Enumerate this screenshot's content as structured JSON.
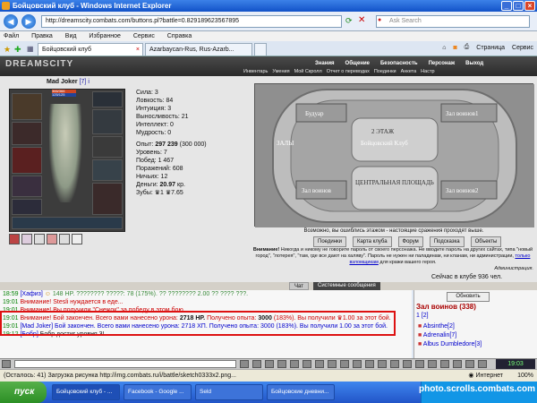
{
  "window": {
    "title": "Бойцовский клуб - Windows Internet Explorer"
  },
  "address": {
    "url": "http://dreamscity.combats.com/buttons.pl?battle=0.829189623567895",
    "search_placeholder": "Ask Search"
  },
  "menu": [
    "Файл",
    "Правка",
    "Вид",
    "Избранное",
    "Сервис",
    "Справка"
  ],
  "tabs": [
    {
      "label": "Бойцовский клуб"
    },
    {
      "label": "Azarbaycan-Rus, Rus-Azarb..."
    }
  ],
  "tab_tools": {
    "page": "Страница",
    "service": "Сервис"
  },
  "game": {
    "logo": "DREAMSCITY",
    "nav": [
      "Знания",
      "Общение",
      "Безопасность",
      "Персонаж",
      "Выход"
    ],
    "subnav": [
      "Инвентарь",
      "Умения",
      "Мой Скролл",
      "Отчет о переводах",
      "Поединки",
      "Анкета",
      "Настр"
    ],
    "char": {
      "name": "Mad Joker",
      "level": "[7]",
      "badge": "i",
      "hp": "366/366",
      "mp": "125/125"
    },
    "stats": [
      "Сила: 3",
      "Ловкость: 84",
      "Интуиция: 3",
      "Выносливость: 21",
      "Интеллект: 0",
      "Мудрость: 0"
    ],
    "stats2": {
      "exp_label": "Опыт:",
      "exp_value": "297 239",
      "exp_next": "(300 000)",
      "level": "Уровень: 7",
      "wins": "Побед: 1 467",
      "losses": "Поражений: 608",
      "draws": "Ничьих: 12",
      "money_label": "Деньги:",
      "money_value": "20.97",
      "money_unit": "кр.",
      "teeth": "Зубы: ♛1 ♛7.65"
    },
    "map": {
      "labels": [
        "Будуар",
        "Зал воинов1",
        "2 ЭТАЖ",
        "Бойцовский Клуб",
        "ЗАЛЫ",
        "ЦЕНТРАЛЬНАЯ ПЛОЩАДЬ",
        "Зал воинов",
        "Зал воинов2"
      ]
    },
    "map_caption": "Возможно, вы ошиблись этажом - настоящие сражения проходят выше.",
    "buttons": [
      "Поединки",
      "Карта клуба",
      "Форум",
      "Подсказка",
      "Объекты"
    ],
    "warning": {
      "strong": "Внимание!",
      "text": "Никогда и никому не говорите пароль от своего персонажа. Не вводите пароль на других сайтах, типа \"новый город\", \"лотерея\", \"там, где все дают на халяву\". Пароль не нужен ни паладинам, ни кланам, ни администрации,",
      "link": "только взломщикам",
      "text2": "для кражи вашего героя.",
      "admin": "Администрация."
    },
    "online": "Сейчас в клубе 936 чел."
  },
  "chat": {
    "tab_chat": "Чат",
    "tab_system": "Системные сообщения",
    "lines": [
      {
        "time": "18:59",
        "who": "[Хафиз]",
        "text": "148 HP. ???????? ?????: 78 (175%). ?? ???????? 2.00 ?? ???? ???."
      },
      {
        "time": "19:01",
        "alert": "Внимание!",
        "text": "Stesli нуждается в еде..."
      },
      {
        "time": "19:01",
        "alert": "Внимание!",
        "text": "Вы получили \"Снежок\" за победу в этом бою"
      },
      {
        "time": "19:01",
        "alert": "Внимание!",
        "text1": "Бой закончен. Всего вами нанесено урона:",
        "hp": "2718 HP.",
        "text2": "Получено опыта:",
        "exp": "3000",
        "text3": "(183%). Вы получили ♛1.00 за этот бой."
      },
      {
        "time": "19:01",
        "who": "[Mad Joker]",
        "text": "Бой закончен. Всего вами нанесено урона: 2718 ХП. Получено опыта: 3000 (183%). Вы получили 1.00 за этот бой."
      },
      {
        "time": "19:12",
        "who": "[Бобр]",
        "text": "Бобр достиг уровня 3!"
      }
    ]
  },
  "room": {
    "refresh": "Обновить",
    "title": "Зал воинов (338)",
    "pages": "1 [2]",
    "players": [
      "Absinthe[2]",
      "Adrenalin[7]",
      "Albus Dumbledore[3]"
    ]
  },
  "clock": "19:03",
  "status": {
    "left": "(Осталось: 41) Загрузка рисунка http://img.combats.ru/i/battle/sketch0333x2.png...",
    "zone": "Интернет",
    "zoom": "100%"
  },
  "taskbar": {
    "start": "пуск",
    "tasks": [
      "Бойцовский клуб - ...",
      "Facebook - Google ...",
      "Seld",
      "Бойцовские дневни..."
    ]
  },
  "watermark": "photo.scrolls.combats.com"
}
